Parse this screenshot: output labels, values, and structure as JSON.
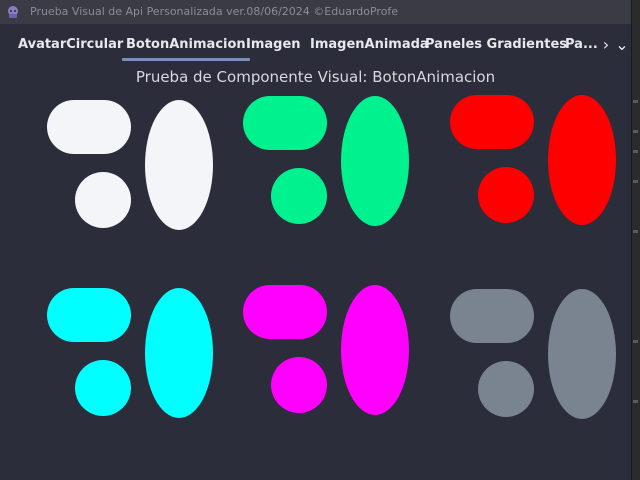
{
  "window": {
    "title": "Prueba Visual de Api Personalizada ver.08/06/2024 ©EduardoProfe"
  },
  "tabs": [
    {
      "label": "AvatarCircular"
    },
    {
      "label": "BotonAnimacion",
      "active": true
    },
    {
      "label": "Imagen"
    },
    {
      "label": "ImagenAnimada"
    },
    {
      "label": "Paneles Gradientes"
    },
    {
      "label": "Pa..."
    }
  ],
  "tab_scroll": {
    "right_icon": "chevron-right-icon",
    "menu_icon": "chevron-down-icon",
    "right_glyph": "›",
    "menu_glyph": "⌄"
  },
  "page": {
    "title": "Prueba de Componente Visual: BotonAnimacion"
  },
  "button_groups": [
    {
      "name": "white",
      "color": "#f4f5f9"
    },
    {
      "name": "green",
      "color": "#00f28f"
    },
    {
      "name": "red",
      "color": "#ff0000"
    },
    {
      "name": "cyan",
      "color": "#00ffff"
    },
    {
      "name": "magenta",
      "color": "#ff00ff"
    },
    {
      "name": "gray",
      "color": "#7a8491"
    }
  ]
}
